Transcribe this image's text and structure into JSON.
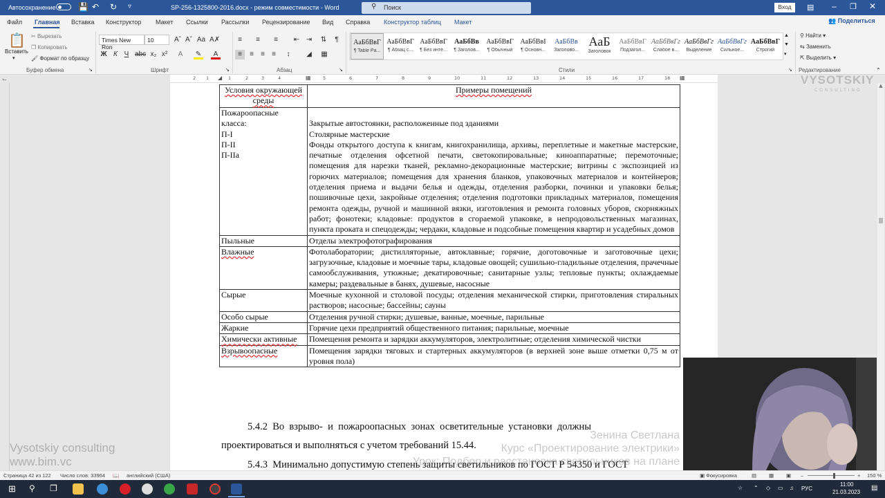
{
  "titlebar": {
    "autosave_label": "Автосохранение",
    "doc_title": "SP-256-1325800-2016.docx  -  режим совместимости  -  Word",
    "search_placeholder": "Поиск",
    "sign_in": "Вход"
  },
  "tabs": [
    "Файл",
    "Главная",
    "Вставка",
    "Конструктор",
    "Макет",
    "Ссылки",
    "Рассылки",
    "Рецензирование",
    "Вид",
    "Справка",
    "Конструктор таблиц",
    "Макет"
  ],
  "share_label": "Поделиться",
  "ribbon": {
    "paste": "Вставить",
    "cut": "Вырезать",
    "copy": "Копировать",
    "format_painter": "Формат по образцу",
    "clipboard_group": "Буфер обмена",
    "font_name": "Times New Ron",
    "font_size": "10",
    "font_group": "Шрифт",
    "paragraph_group": "Абзац",
    "styles_group": "Стили",
    "styles": [
      {
        "sample": "АаБбВвГ",
        "name": "¶ Table Pa..."
      },
      {
        "sample": "АаБбВвГ",
        "name": "¶ Абзац с..."
      },
      {
        "sample": "АаБбВвГ",
        "name": "¶ Без инте..."
      },
      {
        "sample": "АаБбВв",
        "name": "¶ Заголов..."
      },
      {
        "sample": "АаБбВвГ",
        "name": "¶ Обычный"
      },
      {
        "sample": "АаБбВвІ",
        "name": "¶ Основн..."
      },
      {
        "sample": "АаБбВв",
        "name": "Заголово..."
      },
      {
        "sample": "АаБ",
        "name": "Заголовок"
      },
      {
        "sample": "АаБбВвГ",
        "name": "Подзагол..."
      },
      {
        "sample": "АаБбВвГг",
        "name": "Слабое в..."
      },
      {
        "sample": "АаБбВвГг",
        "name": "Выделение"
      },
      {
        "sample": "АаБбВвГг",
        "name": "Сильное..."
      },
      {
        "sample": "АаБбВвГ",
        "name": "Строгий"
      }
    ],
    "find": "Найти",
    "replace": "Заменить",
    "select": "Выделить",
    "editing_group": "Редактирование"
  },
  "ruler_numbers": [
    "2",
    "1",
    "1",
    "2",
    "3",
    "4",
    "5",
    "6",
    "7",
    "8",
    "9",
    "10",
    "11",
    "12",
    "13",
    "14",
    "15",
    "16",
    "17",
    "18"
  ],
  "table": {
    "header": [
      "Условия окружающей среды",
      "Примеры помещений"
    ],
    "rows": [
      {
        "c1": "Пожароопасные класса:\nП-I\nП-II\nП-IIa",
        "c2": "\nЗакрытые автостоянки, расположенные под зданиями\nСтолярные мастерские\nФонды открытого доступа к книгам, книгохранилища, архивы, переплетные и макетные мастерские, печатные отделения офсетной печати, светокопировальные; киноаппаратные; перемоточные; помещения для нарезки тканей, рекламно-декорационные мастерские; витрины с экспозицией из горючих материалов; помещения для хранения бланков, упаковочных материалов и контейнеров; отделения приема и выдачи белья и одежды, отделения разборки, починки и упаковки белья; пошивочные цехи, закройные отделения; отделения подготовки прикладных материалов, помещения ремонта одежды, ручной и машинной вязки, изготовления и ремонта головных уборов, скорняжных работ; фонотеки; кладовые: продуктов в сгораемой упаковке, в непродовольственных магазинах, пункта проката и спецодежды; чердаки, кладовые и подсобные помещения квартир и усадебных домов"
      },
      {
        "c1": "Пыльные",
        "c2": "Отделы электрофотографирования"
      },
      {
        "c1": "Влажные",
        "c2": "Фотолаборатории; дистилляторные, автоклавные; горячие, доготовочные и заготовочные цехи; загрузочные, кладовые и моечные тары, кладовые овощей; сушильно-гладильные отделения, прачечные самообслуживания, утюжные; декатировочные; санитарные узлы; тепловые пункты; охлаждаемые камеры; раздевальные в банях, душевые, насосные"
      },
      {
        "c1": "Сырые",
        "c2": "Моечные кухонной и столовой посуды; отделения механической стирки, приготовления стиральных растворов; насосные; бассейны; сауны"
      },
      {
        "c1": "Особо сырые",
        "c2": "Отделения ручной стирки; душевые, ванные, моечные, парильные"
      },
      {
        "c1": "Жаркие",
        "c2": "Горячие цехи предприятий общественного питания; парильные, моечные"
      },
      {
        "c1": "Химически активные",
        "c2": "Помещения ремонта и зарядки аккумуляторов, электролитные; отделения химической чистки"
      },
      {
        "c1": "Взрывоопасные",
        "c2": "Помещения зарядки тяговых и стартерных аккумуляторов (в верхней зоне выше отметки 0,75 м от уровня пола)"
      }
    ]
  },
  "paragraphs": [
    "5.4.2  Во  взрыво-  и  пожароопасных  зонах  осветительные  установки  должны",
    "проектироваться и выполняться с учетом требований 15.44.",
    "5.4.3  Минимально допустимую степень защиты светильников по ГОСТ Р 54350 и ГОСТ"
  ],
  "watermark": {
    "left_line1": "Vysotskiy consulting",
    "left_line2": "www.bim.vc",
    "right_line1": "Зенина Светлана",
    "right_line2": "Курс «Проектирование электрики»",
    "right_line3": "Урок: Подбор и расстановка светильников на плане",
    "logo": "VYSOTSKIY",
    "logo_sub": "CONSULTING"
  },
  "status": {
    "page": "Страница 42 из 122",
    "words": "Число слов: 33964",
    "language": "английский (США)",
    "focus": "Фокусировка",
    "zoom": "150 %"
  },
  "taskbar": {
    "language": "РУС",
    "time": "11:00",
    "date": "21.03.2023"
  },
  "colors": {
    "word_blue": "#2b579a",
    "spell_red": "#d33"
  }
}
